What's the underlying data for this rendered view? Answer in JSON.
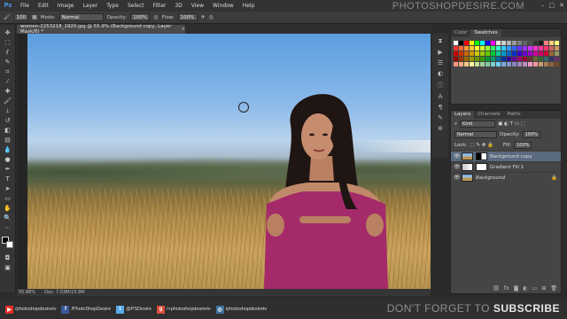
{
  "app": {
    "logo": "Ps"
  },
  "menu": [
    "File",
    "Edit",
    "Image",
    "Layer",
    "Type",
    "Select",
    "Filter",
    "3D",
    "View",
    "Window",
    "Help"
  ],
  "watermark": "PHOTOSHOPDESIRE.COM",
  "options": {
    "brush_size": "100",
    "mode_label": "Mode:",
    "mode_value": "Normal",
    "opacity_label": "Opacity:",
    "opacity_value": "100%",
    "flow_label": "Flow:",
    "flow_value": "100%"
  },
  "document": {
    "tab_title": "women-2253218_1920.jpg @ 55.9% (Background copy, Layer Mask/8) *",
    "zoom": "55.88%",
    "doc_info": "Doc: 7.03M/15.8M"
  },
  "panels": {
    "color_tab": "Color",
    "swatches_tab": "Swatches",
    "swatch_colors": [
      "#ffffff",
      "#000000",
      "#ff0000",
      "#ffff00",
      "#00ff00",
      "#00ffff",
      "#0000ff",
      "#ff00ff",
      "#e6e6e6",
      "#cccccc",
      "#b3b3b3",
      "#999999",
      "#808080",
      "#666666",
      "#4d4d4d",
      "#333333",
      "#1a1a1a",
      "#ff8080",
      "#ffcc80",
      "#ffff80",
      "#ff3333",
      "#ff6633",
      "#ff9933",
      "#ffcc33",
      "#ffff33",
      "#ccff33",
      "#99ff33",
      "#33ff66",
      "#33ffcc",
      "#33ccff",
      "#3399ff",
      "#3366ff",
      "#6633ff",
      "#9933ff",
      "#cc33ff",
      "#ff33cc",
      "#ff3399",
      "#ff3366",
      "#cc6666",
      "#cc9966",
      "#cc0000",
      "#cc3300",
      "#cc6600",
      "#cc9900",
      "#cccc00",
      "#99cc00",
      "#66cc00",
      "#00cc33",
      "#00cc99",
      "#0099cc",
      "#0066cc",
      "#0033cc",
      "#3300cc",
      "#6600cc",
      "#9900cc",
      "#cc0099",
      "#cc0066",
      "#cc0033",
      "#996633",
      "#999966",
      "#990000",
      "#993300",
      "#996600",
      "#999900",
      "#669900",
      "#339900",
      "#009933",
      "#009966",
      "#006699",
      "#003399",
      "#330099",
      "#660099",
      "#990066",
      "#990033",
      "#663333",
      "#666633",
      "#336633",
      "#336666",
      "#333366",
      "#663366",
      "#f7977a",
      "#f9ad81",
      "#fdc68a",
      "#fff79a",
      "#c4df9b",
      "#a2d39c",
      "#82ca9d",
      "#7bcdc8",
      "#6ecff6",
      "#7ea7d8",
      "#8493ca",
      "#8882be",
      "#a187be",
      "#bc8dbf",
      "#f49ac2",
      "#f6989d",
      "#c69c6d",
      "#a67c52",
      "#8c6239",
      "#754c24"
    ],
    "layers_tab": "Layers",
    "channels_tab": "Channels",
    "paths_tab": "Paths",
    "kind_label": "Kind",
    "blend_mode": "Normal",
    "opacity_label": "Opacity:",
    "opacity_value": "100%",
    "lock_label": "Lock:",
    "fill_label": "Fill:",
    "fill_value": "100%",
    "layers": [
      "Background copy",
      "Gradient Fill 1",
      "Background"
    ]
  },
  "footer": {
    "youtube": "/photoshopdesiretv",
    "facebook": "/PhotoShopDesire",
    "twitter": "@PSDesire",
    "googleplus": "/+photoshopdesiretv",
    "instagram": "/photoshopdesiretv",
    "cta_light": "DON'T FORGET TO",
    "cta_bold": "SUBSCRIBE",
    "colors": {
      "youtube": "#e52d27",
      "facebook": "#3b5998",
      "twitter": "#55acee",
      "googleplus": "#dd4b39",
      "instagram": "#3f729b"
    }
  }
}
